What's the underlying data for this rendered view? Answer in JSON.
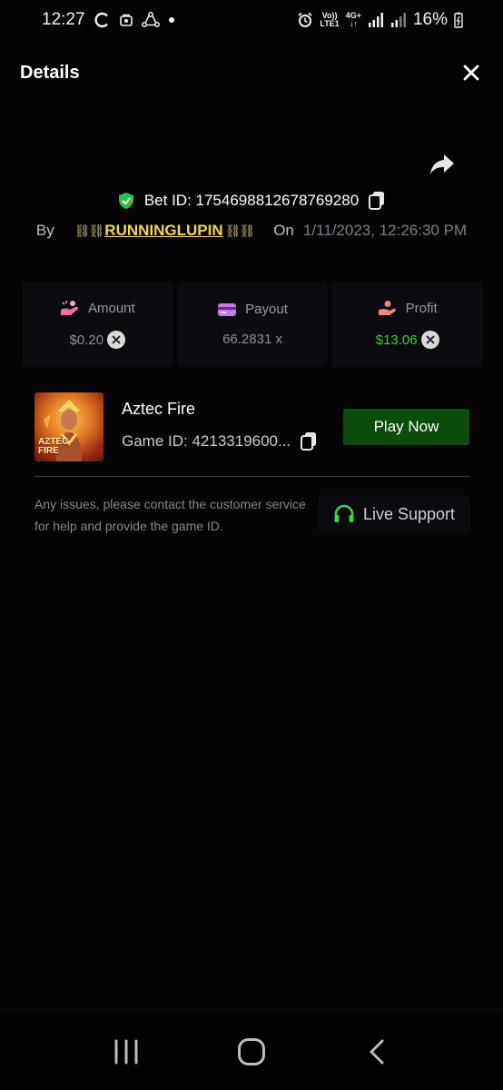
{
  "status_bar": {
    "time": "12:27",
    "network_top": "Vo))",
    "network_bottom": "LTE1",
    "network_type": "4G+",
    "battery": "16%"
  },
  "header": {
    "title": "Details"
  },
  "bet": {
    "bet_id_label": "Bet ID: 1754698812678769280",
    "by_label": "By",
    "username": "RUNNINGLUPIN",
    "on_label": "On",
    "date": "1/11/2023, 12:26:30 PM"
  },
  "stats": {
    "amount_label": "Amount",
    "amount_value": "$0.20",
    "payout_label": "Payout",
    "payout_value": "66.2831 x",
    "profit_label": "Profit",
    "profit_value": "$13.06"
  },
  "game": {
    "name": "Aztec Fire",
    "game_id": "Game ID: 4213319600...",
    "thumb_line1": "AZTEC",
    "thumb_line2": "FIRE",
    "play_label": "Play Now"
  },
  "support": {
    "help_text": "Any issues, please contact the customer service for help and provide the game ID.",
    "button_label": "Live Support"
  },
  "colors": {
    "accent_green": "#37d137",
    "play_button": "#0b4d0b",
    "username": "#f3d44b"
  }
}
